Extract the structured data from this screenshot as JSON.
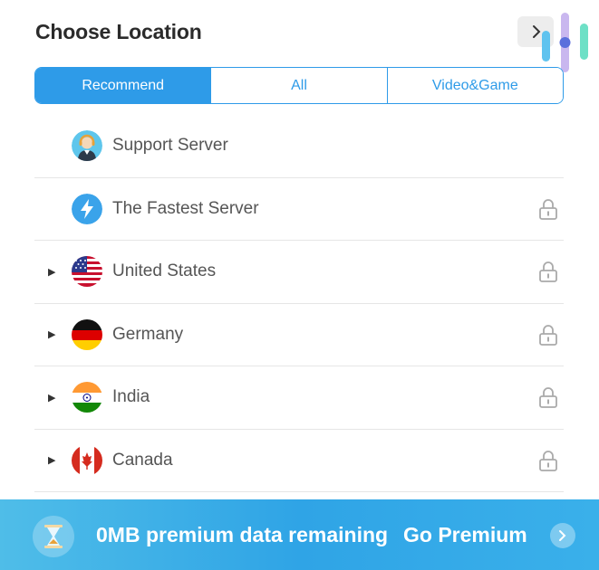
{
  "header": {
    "title": "Choose Location",
    "close_icon": "chevron-right-icon"
  },
  "tabs": [
    {
      "label": "Recommend",
      "active": true
    },
    {
      "label": "All",
      "active": false
    },
    {
      "label": "Video&Game",
      "active": false
    }
  ],
  "locations": [
    {
      "label": "Support Server",
      "icon": "support-agent-icon",
      "expandable": false,
      "locked": false
    },
    {
      "label": "The Fastest Server",
      "icon": "lightning-icon",
      "expandable": false,
      "locked": true
    },
    {
      "label": "United States",
      "icon": "us-flag-icon",
      "expandable": true,
      "locked": true
    },
    {
      "label": "Germany",
      "icon": "germany-flag-icon",
      "expandable": true,
      "locked": true
    },
    {
      "label": "India",
      "icon": "india-flag-icon",
      "expandable": true,
      "locked": true
    },
    {
      "label": "Canada",
      "icon": "canada-flag-icon",
      "expandable": true,
      "locked": true
    }
  ],
  "banner": {
    "data_text": "0MB premium data remaining",
    "cta_label": "Go Premium",
    "icon": "hourglass-icon"
  },
  "colors": {
    "accent": "#2e9be8",
    "banner": "#3aa9e8",
    "divider": "#e6e6e6"
  }
}
